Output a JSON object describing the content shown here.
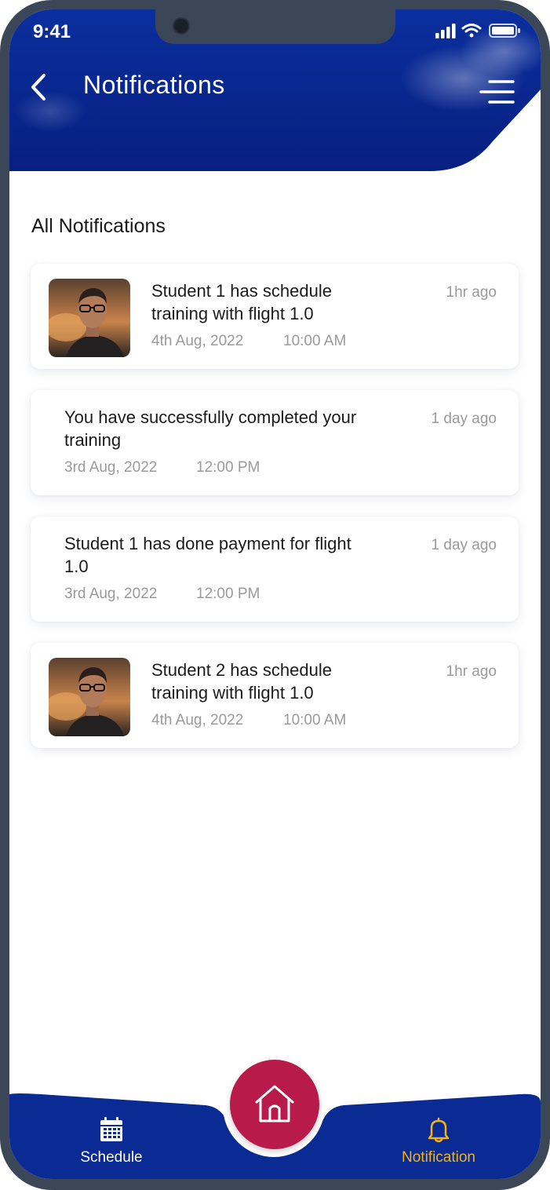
{
  "status_bar": {
    "time": "9:41"
  },
  "header": {
    "title": "Notifications",
    "background_color": "#0a2a94",
    "back_icon": "chevron-left-icon",
    "menu_icon": "menu-lines-icon"
  },
  "section_title": "All Notifications",
  "notifications": [
    {
      "message": "Student 1 has schedule training with flight 1.0",
      "date": "4th Aug, 2022",
      "time": "10:00 AM",
      "ago": "1hr ago",
      "has_avatar": true
    },
    {
      "message": "You have successfully completed your training",
      "date": "3rd Aug, 2022",
      "time": "12:00 PM",
      "ago": "1 day ago",
      "has_avatar": false
    },
    {
      "message": "Student 1 has  done payment for flight 1.0",
      "date": "3rd Aug, 2022",
      "time": "12:00 PM",
      "ago": "1 day ago",
      "has_avatar": false
    },
    {
      "message": "Student 2 has schedule training with flight 1.0",
      "date": "4th Aug, 2022",
      "time": "10:00 AM",
      "ago": "1hr ago",
      "has_avatar": true
    }
  ],
  "bottom_nav": {
    "schedule_label": "Schedule",
    "notification_label": "Notification",
    "home_icon": "home-icon",
    "nav_color": "#0a2a94",
    "home_button_color": "#b81a49",
    "active_color": "#f2b318"
  }
}
